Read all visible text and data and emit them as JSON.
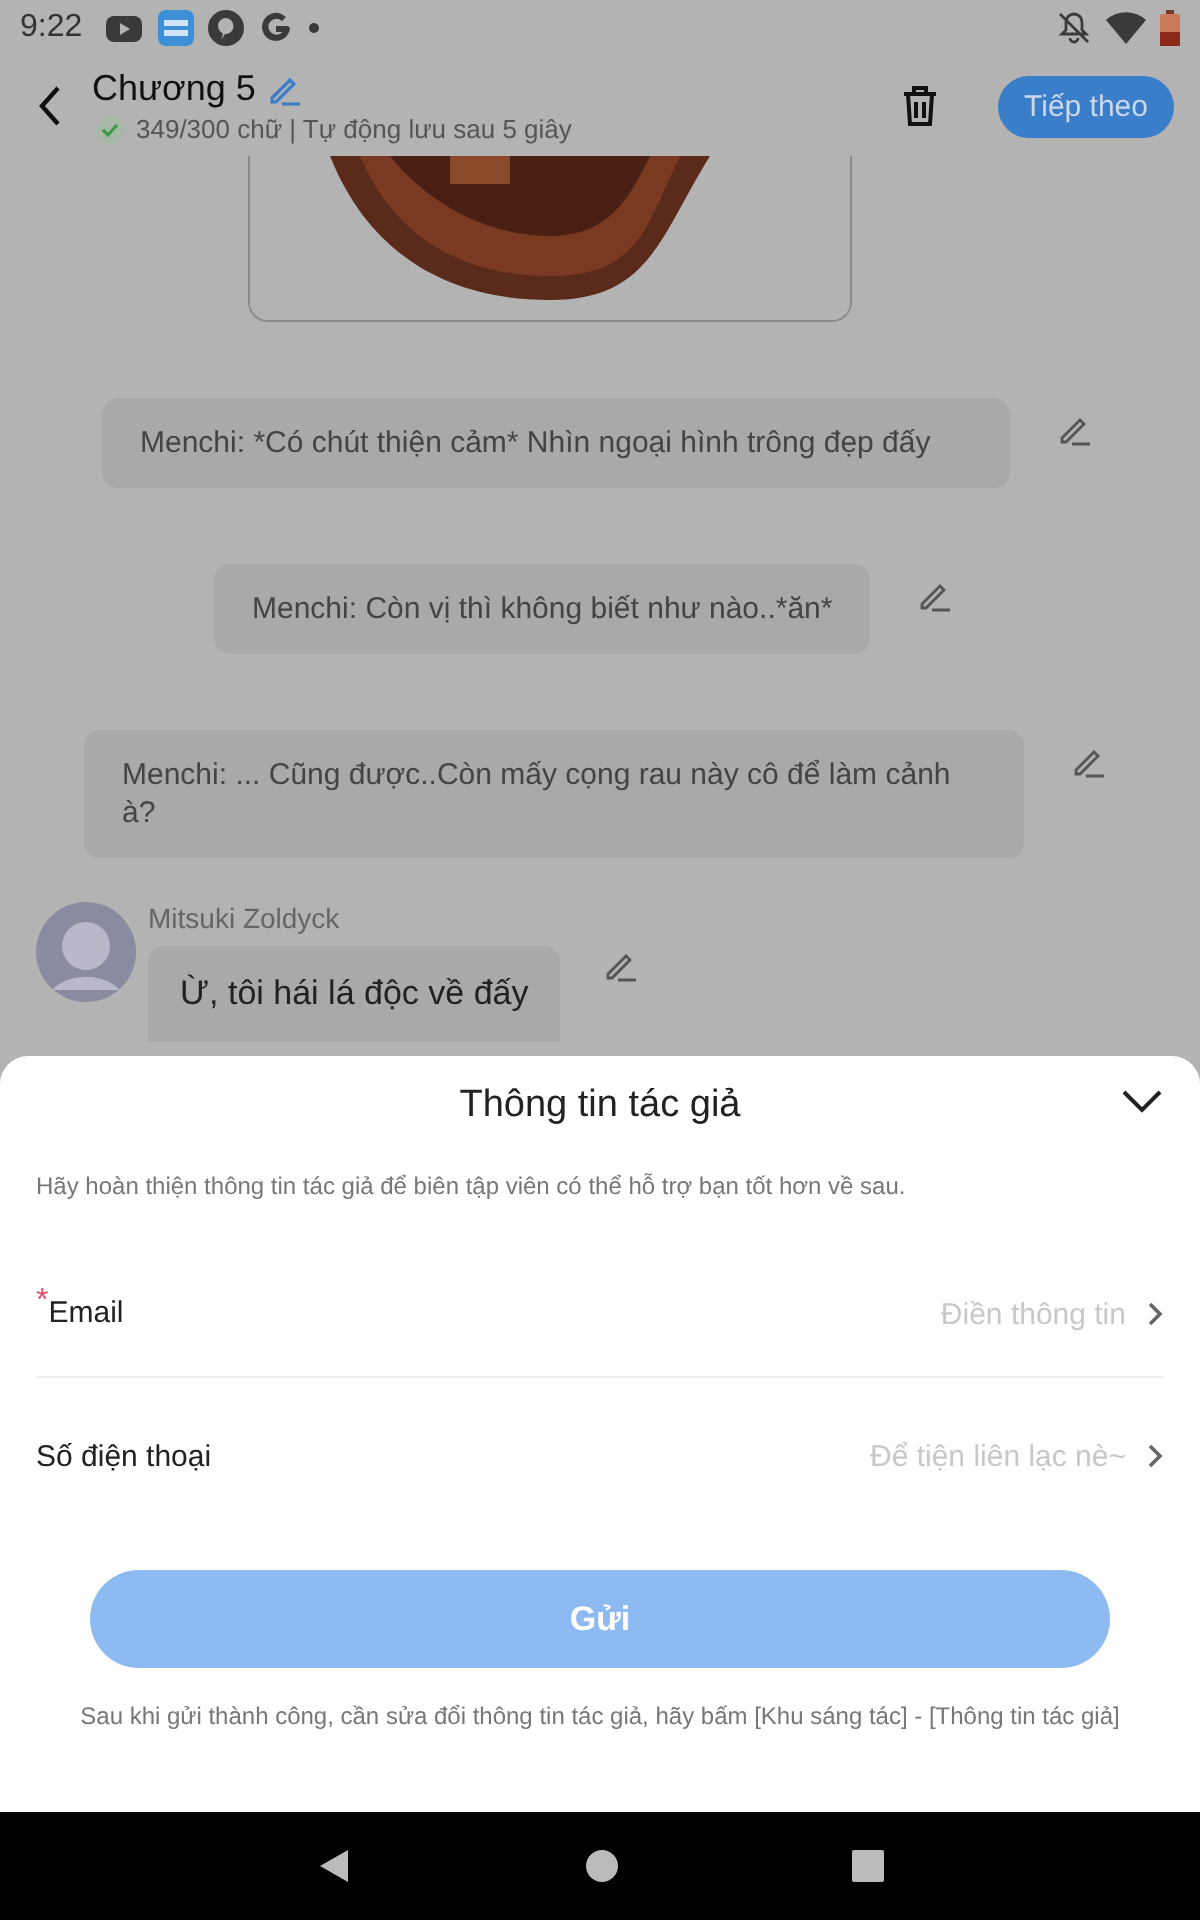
{
  "status_bar": {
    "time": "9:22"
  },
  "header": {
    "title": "Chương 5",
    "status": "349/300 chữ | Tự động lưu sau 5 giây",
    "next_button": "Tiếp theo"
  },
  "messages": [
    {
      "kind": "narration",
      "text": "Menchi: *Có chút thiện cảm* Nhìn ngoại hình trông đẹp đấy"
    },
    {
      "kind": "narration",
      "text": "Menchi: Còn vị thì không biết như nào..*ăn*"
    },
    {
      "kind": "narration",
      "text": "Menchi: ... Cũng được..Còn mấy cọng rau này cô để làm cảnh à?"
    },
    {
      "kind": "character",
      "speaker": "Mitsuki Zoldyck",
      "text": "Ừ, tôi hái lá độc về đấy"
    }
  ],
  "sheet": {
    "title": "Thông tin tác giả",
    "description": "Hãy hoàn thiện thông tin tác giả để biên tập viên có thể hỗ trợ bạn tốt hơn về sau.",
    "fields": [
      {
        "label": "Email",
        "placeholder": "Điền thông tin",
        "required_mark": "*"
      },
      {
        "label": "Số điện thoại",
        "placeholder": "Để tiện liên lạc nè~"
      }
    ],
    "submit": {
      "label": "Gửi",
      "disabled": true
    },
    "footnote": "Sau khi gửi thành công, cần sửa đổi thông tin tác giả, hãy bấm [Khu sáng tác] - [Thông tin tác giả]"
  }
}
